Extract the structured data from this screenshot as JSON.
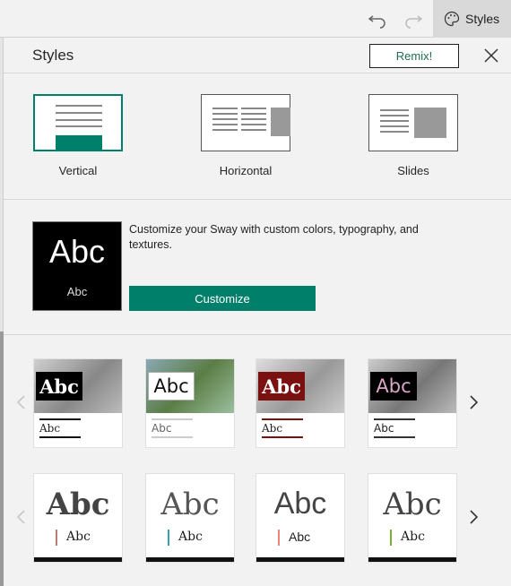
{
  "toolbar": {
    "styles_label": "Styles"
  },
  "panel": {
    "title": "Styles",
    "remix_label": "Remix!"
  },
  "layouts": [
    {
      "label": "Vertical",
      "selected": true
    },
    {
      "label": "Horizontal",
      "selected": false
    },
    {
      "label": "Slides",
      "selected": false
    }
  ],
  "customize": {
    "preview_big": "Abc",
    "preview_small": "Abc",
    "description": "Customize your Sway with custom colors, typography, and textures.",
    "button_label": "Customize"
  },
  "style_row1": [
    {
      "title": "Abc",
      "subtitle": "Abc",
      "tag_bg": "#000000",
      "tag_fg": "#ffffff",
      "accent": "#111111"
    },
    {
      "title": "Abc",
      "subtitle": "Abc",
      "tag_bg": "#ffffff",
      "tag_fg": "#111111",
      "accent": "#cccccc"
    },
    {
      "title": "Abc",
      "subtitle": "Abc",
      "tag_bg": "#7a1010",
      "tag_fg": "#ffffff",
      "accent": "#7a1010"
    },
    {
      "title": "Abc",
      "subtitle": "Abc",
      "tag_bg": "#000000",
      "tag_fg": "#d9a6c6",
      "accent": "#333333"
    }
  ],
  "style_row2": [
    {
      "big": "Abc",
      "small": "Abc",
      "accent": "#b87d6e"
    },
    {
      "big": "Abc",
      "small": "Abc",
      "accent": "#3aa0b4"
    },
    {
      "big": "Abc",
      "small": "Abc",
      "accent": "#e8867a"
    },
    {
      "big": "Abc",
      "small": "Abc",
      "accent": "#7ab030"
    }
  ],
  "colors": {
    "accent_green": "#00806b",
    "panel_bg": "#f2f2f2"
  }
}
